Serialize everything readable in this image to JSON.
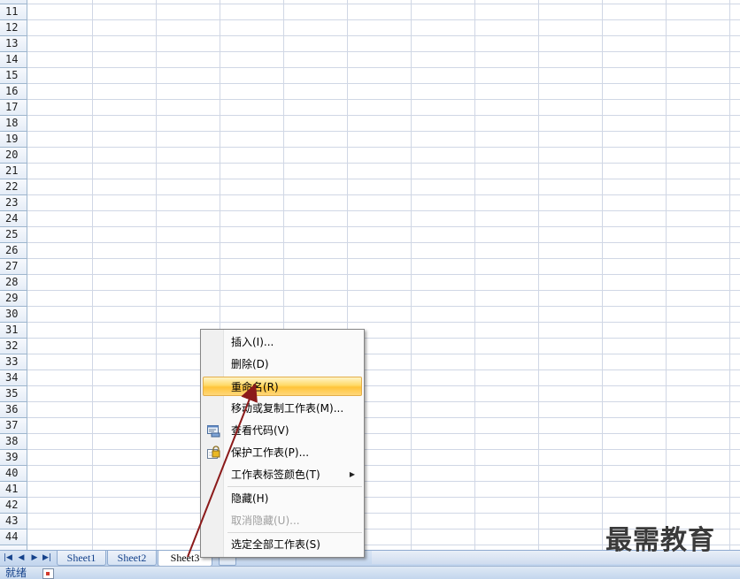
{
  "grid": {
    "rows": [
      "11",
      "12",
      "13",
      "14",
      "15",
      "16",
      "17",
      "18",
      "19",
      "20",
      "21",
      "22",
      "23",
      "24",
      "25",
      "26",
      "27",
      "28",
      "29",
      "30",
      "31",
      "32",
      "33",
      "34",
      "35",
      "36",
      "37",
      "38",
      "39",
      "40",
      "41",
      "42",
      "43",
      "44"
    ]
  },
  "sheet_tabs": {
    "nav": [
      "first-sheet",
      "prev-sheet",
      "next-sheet",
      "last-sheet"
    ],
    "tabs": [
      {
        "label": "Sheet1",
        "active": false
      },
      {
        "label": "Sheet2",
        "active": false
      },
      {
        "label": "Sheet3",
        "active": true
      }
    ]
  },
  "status_bar": {
    "text": "就绪"
  },
  "context_menu": {
    "items": [
      {
        "label": "插入(I)...",
        "state": "normal"
      },
      {
        "label": "删除(D)",
        "state": "normal"
      },
      {
        "label": "重命名(R)",
        "state": "hover"
      },
      {
        "label": "移动或复制工作表(M)...",
        "state": "normal"
      },
      {
        "label": "查看代码(V)",
        "state": "normal",
        "icon": "view-code-icon"
      },
      {
        "label": "保护工作表(P)...",
        "state": "normal",
        "icon": "protect-sheet-icon"
      },
      {
        "label": "工作表标签颜色(T)",
        "state": "normal",
        "submenu": true
      },
      {
        "label": "隐藏(H)",
        "state": "normal"
      },
      {
        "label": "取消隐藏(U)...",
        "state": "disabled"
      },
      {
        "label": "选定全部工作表(S)",
        "state": "normal"
      }
    ]
  },
  "watermark": {
    "text": "最需教育"
  },
  "colors": {
    "menu_hover": "#ffd966",
    "annotation_arrow": "#8b1a1a",
    "grid_line": "#d0d7e5"
  }
}
